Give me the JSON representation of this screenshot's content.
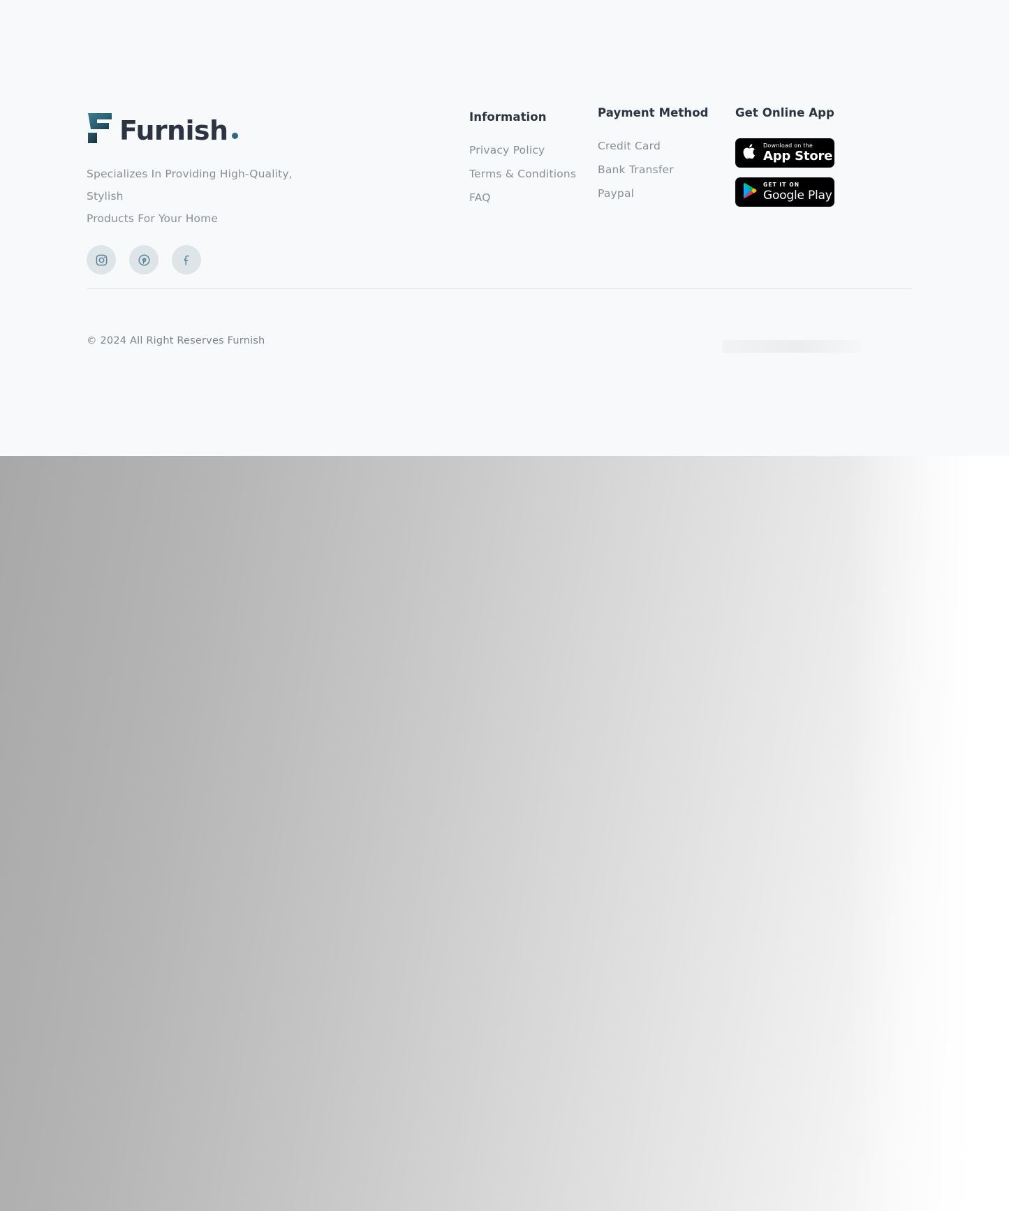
{
  "brand": {
    "logo_icon": "furnish-f-mark",
    "name": "Furnish",
    "dot": "•",
    "tagline_line1": "Specializes In Providing High-Quality, Stylish",
    "tagline_line2": "Products For Your Home",
    "accent_color": "#2a6a7c",
    "wordmark_color": "#2b3440",
    "socials": [
      {
        "name": "instagram",
        "icon": "instagram-icon"
      },
      {
        "name": "pinterest",
        "icon": "pinterest-icon"
      },
      {
        "name": "facebook",
        "icon": "facebook-icon"
      }
    ]
  },
  "information": {
    "title": "Information",
    "links": [
      {
        "label": "Privacy Policy"
      },
      {
        "label": "Terms & Conditions"
      },
      {
        "label": "FAQ"
      }
    ]
  },
  "payment": {
    "title": "Payment Method",
    "links": [
      {
        "label": "Credit Card"
      },
      {
        "label": "Bank Transfer"
      },
      {
        "label": "Paypal"
      }
    ]
  },
  "app": {
    "title": "Get Online App",
    "badges": [
      {
        "icon": "apple-icon",
        "sub": "Download on the",
        "main": "App Store"
      },
      {
        "icon": "google-play-icon",
        "sub": "GET IT ON",
        "main": "Google Play"
      }
    ]
  },
  "footer_bottom": {
    "copyright": "© 2024 All Right Reserves Furnish"
  },
  "colors": {
    "footer_background": "#f8f9fa",
    "muted_text": "#8a8f96",
    "heading_text": "#2b3440",
    "social_bubble": "#dde5e9",
    "divider": "#e2e4e7"
  }
}
